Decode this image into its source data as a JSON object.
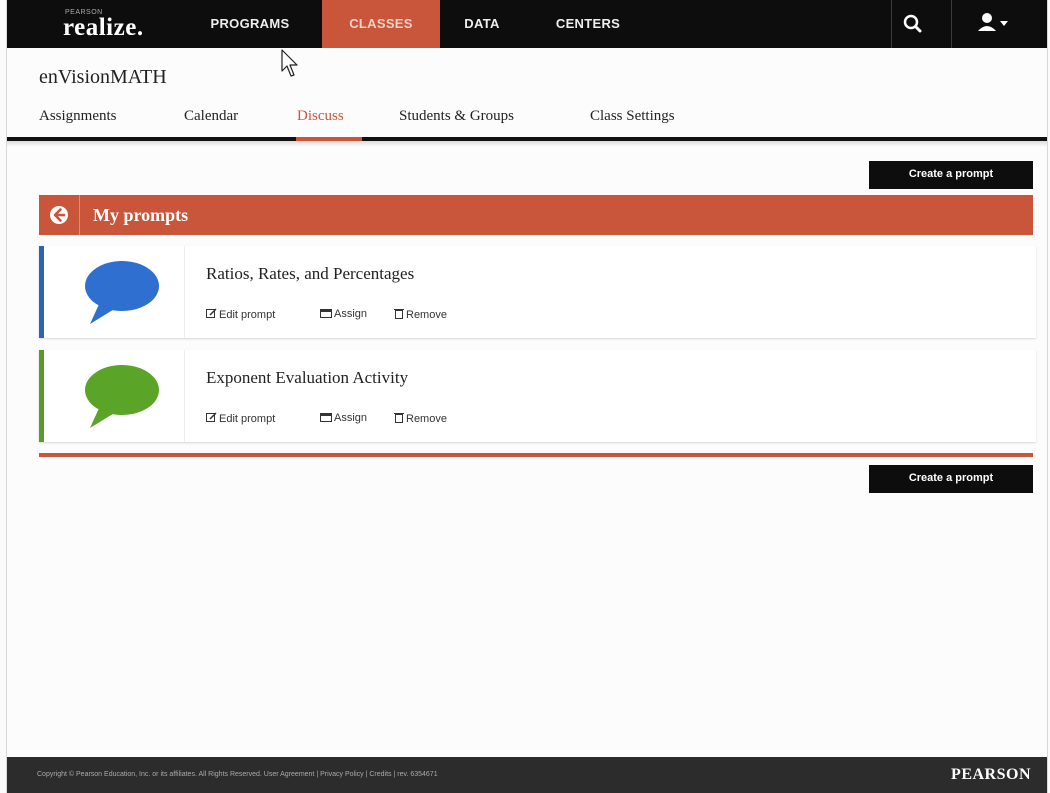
{
  "app": {
    "logo_super": "PEARSON",
    "logo_word": "realize."
  },
  "topnav": {
    "items": [
      {
        "label": "PROGRAMS"
      },
      {
        "label": "CLASSES",
        "active": true
      },
      {
        "label": "DATA"
      },
      {
        "label": "CENTERS"
      }
    ],
    "icons": [
      "search-icon",
      "user-icon"
    ]
  },
  "class": {
    "name": "enVisionMATH",
    "tabs": [
      {
        "label": "Assignments"
      },
      {
        "label": "Calendar"
      },
      {
        "label": "Discuss",
        "active": true
      },
      {
        "label": "Students & Groups"
      },
      {
        "label": "Class Settings"
      }
    ]
  },
  "prompts": {
    "create_label": "Create a prompt",
    "header": "My prompts",
    "items": [
      {
        "title": "Ratios, Rates, and Percentages",
        "accent": "#2e62b4",
        "icon_color": "#2f6fd0"
      },
      {
        "title": "Exponent Evaluation Activity",
        "accent": "#5a9a2c",
        "icon_color": "#5aa428"
      }
    ],
    "actions": {
      "edit": "Edit prompt",
      "assign": "Assign",
      "remove": "Remove"
    }
  },
  "footer": {
    "copyright": "Copyright © Pearson Education, Inc. or its affiliates. All Rights Reserved. User Agreement | Privacy Policy | Credits | rev. 6354671",
    "brand": "PEARSON"
  },
  "colors": {
    "accent": "#c9553a",
    "nav": "#0d0d0d"
  }
}
